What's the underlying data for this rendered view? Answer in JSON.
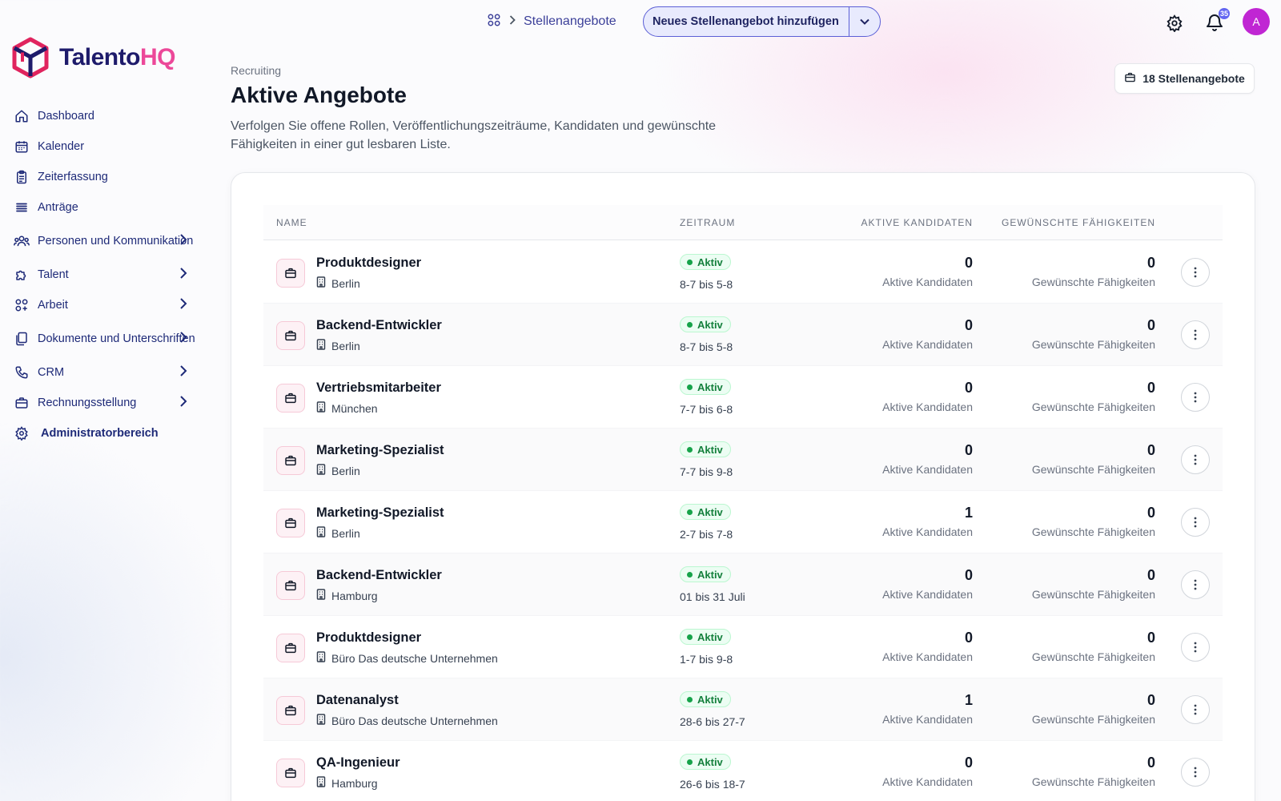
{
  "brand": {
    "name_part1": "Talento",
    "name_part2": "HQ"
  },
  "sidebar": {
    "items": [
      {
        "label": "Dashboard",
        "icon": "home-icon",
        "expandable": false
      },
      {
        "label": "Kalender",
        "icon": "calendar-icon",
        "expandable": false
      },
      {
        "label": "Zeiterfassung",
        "icon": "clipboard-icon",
        "expandable": false
      },
      {
        "label": "Anträge",
        "icon": "list-icon",
        "expandable": false
      },
      {
        "label": "Personen und Kommunikation",
        "icon": "users-icon",
        "expandable": true
      },
      {
        "label": "Talent",
        "icon": "puzzle-icon",
        "expandable": true
      },
      {
        "label": "Arbeit",
        "icon": "apps-icon",
        "expandable": true
      },
      {
        "label": "Dokumente und Unterschriften",
        "icon": "documents-icon",
        "expandable": true
      },
      {
        "label": "CRM",
        "icon": "phone-icon",
        "expandable": true
      },
      {
        "label": "Rechnungsstellung",
        "icon": "briefcase-icon",
        "expandable": true
      },
      {
        "label": "Administratorbereich",
        "icon": "gear-icon",
        "expandable": false
      }
    ]
  },
  "topbar": {
    "breadcrumb": "Stellenangebote",
    "new_button": "Neues Stellenangebot hinzufügen",
    "notifications_count": "35",
    "avatar_initial": "A"
  },
  "header": {
    "eyebrow": "Recruiting",
    "title": "Aktive Angebote",
    "description": "Verfolgen Sie offene Rollen, Veröffentlichungszeiträume, Kandidaten und gewünschte Fähigkeiten in einer gut lesbaren Liste.",
    "count_chip": "18 Stellenangebote"
  },
  "table": {
    "columns": [
      "NAME",
      "ZEITRAUM",
      "AKTIVE KANDIDATEN",
      "GEWÜNSCHTE FÄHIGKEITEN"
    ],
    "candidates_label": "Aktive Kandidaten",
    "skills_label": "Gewünschte Fähigkeiten",
    "rows": [
      {
        "name": "Produktdesigner",
        "location": "Berlin",
        "status": "Aktiv",
        "period": "8-7 bis 5-8",
        "candidates": "0",
        "skills": "0"
      },
      {
        "name": "Backend-Entwickler",
        "location": "Berlin",
        "status": "Aktiv",
        "period": "8-7 bis 5-8",
        "candidates": "0",
        "skills": "0"
      },
      {
        "name": "Vertriebsmitarbeiter",
        "location": "München",
        "status": "Aktiv",
        "period": "7-7 bis 6-8",
        "candidates": "0",
        "skills": "0"
      },
      {
        "name": "Marketing-Spezialist",
        "location": "Berlin",
        "status": "Aktiv",
        "period": "7-7 bis 9-8",
        "candidates": "0",
        "skills": "0"
      },
      {
        "name": "Marketing-Spezialist",
        "location": "Berlin",
        "status": "Aktiv",
        "period": "2-7 bis 7-8",
        "candidates": "1",
        "skills": "0"
      },
      {
        "name": "Backend-Entwickler",
        "location": "Hamburg",
        "status": "Aktiv",
        "period": "01 bis 31 Juli",
        "candidates": "0",
        "skills": "0"
      },
      {
        "name": "Produktdesigner",
        "location": "Büro Das deutsche Unternehmen",
        "status": "Aktiv",
        "period": "1-7 bis 9-8",
        "candidates": "0",
        "skills": "0"
      },
      {
        "name": "Datenanalyst",
        "location": "Büro Das deutsche Unternehmen",
        "status": "Aktiv",
        "period": "28-6 bis 27-7",
        "candidates": "1",
        "skills": "0"
      },
      {
        "name": "QA-Ingenieur",
        "location": "Hamburg",
        "status": "Aktiv",
        "period": "26-6 bis 18-7",
        "candidates": "0",
        "skills": "0"
      }
    ]
  },
  "colors": {
    "accent": "#1e2a78",
    "brand_pink": "#ec4899",
    "active_green": "#16a34a"
  }
}
